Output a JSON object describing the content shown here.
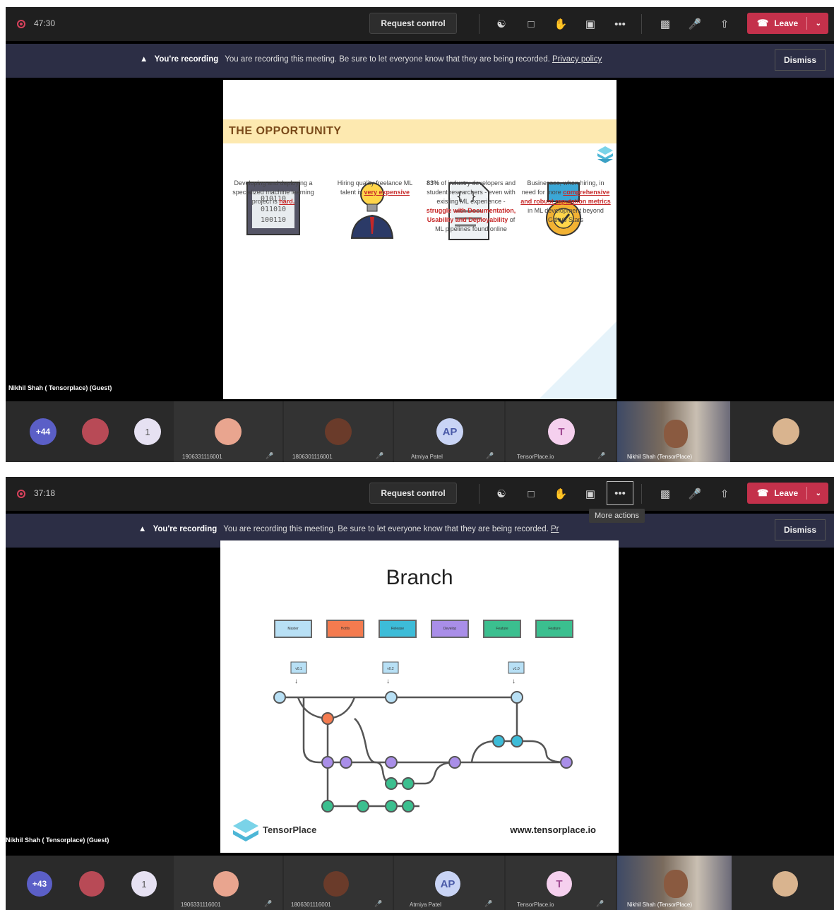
{
  "screens": [
    {
      "timer": "47:30",
      "request_control": "Request control",
      "leave": "Leave",
      "banner": {
        "bold": "You're recording",
        "text": "You are recording this meeting. Be sure to let everyone know that they are being recorded.",
        "link": "Privacy policy",
        "dismiss": "Dismiss"
      },
      "presenter": "Nikhil Shah ( Tensorplace) (Guest)",
      "slide": {
        "title": "THE OPPORTUNITY",
        "binary": [
          "010110",
          "011010",
          "100110"
        ],
        "columns": [
          {
            "text": "Developing and deploying a specialized machine learning project is",
            "highlight": "hard."
          },
          {
            "text": "Hiring quality freelance ML talent is",
            "highlight": "very expensive"
          },
          {
            "text_a": "83%",
            "text_b": "of industry developers and student researchers - even with existing ML experience -",
            "highlight": "struggle with Documentation, Usability and Deployability",
            "text_c": "of ML pipelines found online"
          },
          {
            "text": "Businesses, when hiring, in need for more",
            "highlight": "comprehensive and robust reputation metrics",
            "text_c": "in ML development beyond Github Stars"
          }
        ]
      },
      "participants": [
        {
          "overflow": "+44"
        },
        {
          "badge": "1"
        },
        {
          "name": "1906331116001"
        },
        {
          "name": "1806301116001"
        },
        {
          "initials": "AP",
          "name": "Atmiya Patel"
        },
        {
          "initials": "T",
          "name": "TensorPlace.io"
        },
        {
          "name": "Nikhil Shah (TensorPlace)"
        }
      ]
    },
    {
      "timer": "37:18",
      "request_control": "Request control",
      "leave": "Leave",
      "tooltip": "More actions",
      "banner": {
        "bold": "You're recording",
        "text": "You are recording this meeting. Be sure to let everyone know that they are being recorded.",
        "link": "Pr",
        "dismiss": "Dismiss"
      },
      "presenter": "Nikhil Shah ( Tensorplace) (Guest)",
      "slide": {
        "title": "Branch",
        "chips": [
          "Master",
          "Hotfix",
          "Release",
          "Develop",
          "Feature",
          "Feature"
        ],
        "tags": [
          "v0.1",
          "v0.2",
          "v1.0"
        ],
        "brand": "TensorPlace",
        "url": "www.tensorplace.io"
      },
      "participants": [
        {
          "overflow": "+43"
        },
        {
          "badge": "1"
        },
        {
          "name": "1906331116001"
        },
        {
          "name": "1806301116001"
        },
        {
          "initials": "AP",
          "name": "Atmiya Patel"
        },
        {
          "initials": "T",
          "name": "TensorPlace.io"
        },
        {
          "name": "Nikhil Shah (TensorPlace)"
        }
      ]
    }
  ],
  "colors": {
    "leave": "#c4314b",
    "banner_bg": "#2c2e45",
    "overflow_avatar": "#5b5fc7",
    "ap_avatar": "#c9d4f5",
    "t_avatar": "#f5d0ee"
  },
  "icons": [
    "record-icon",
    "participants-icon",
    "chat-icon",
    "raise-hand-icon",
    "rooms-icon",
    "more-icon",
    "camera-off-icon",
    "mic-off-icon",
    "share-icon",
    "phone-icon"
  ]
}
